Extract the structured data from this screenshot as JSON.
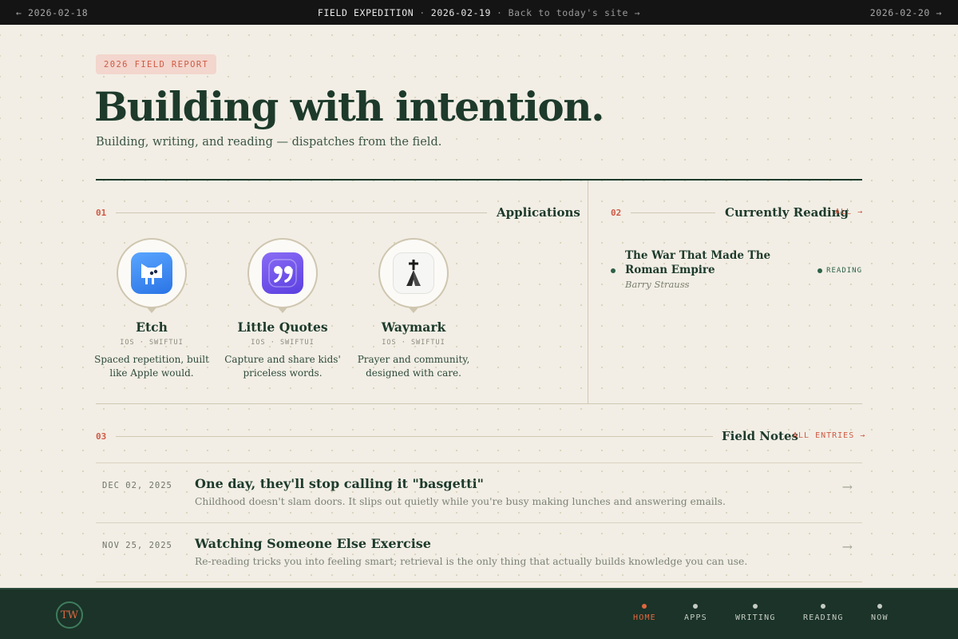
{
  "topbar": {
    "prev": "← 2026-02-18",
    "title": "FIELD EXPEDITION",
    "sep1": "·",
    "date": "2026-02-19",
    "sep2": "·",
    "back_link": "Back to today's site →",
    "next": "2026-02-20 →"
  },
  "hero": {
    "badge": "2026 FIELD REPORT",
    "title": "Building with intention.",
    "subtitle": "Building, writing, and reading — dispatches from the field."
  },
  "applications": {
    "number": "01",
    "title": "Applications",
    "items": [
      {
        "name": "Etch",
        "tags": "IOS · SWIFTUI",
        "description": "Spaced repetition, built like Apple would.",
        "icon": "etch-app-icon"
      },
      {
        "name": "Little Quotes",
        "tags": "IOS · SWIFTUI",
        "description": "Capture and share kids' priceless words.",
        "icon": "quotes-app-icon"
      },
      {
        "name": "Waymark",
        "tags": "IOS · SWIFTUI",
        "description": "Prayer and community, designed with care.",
        "icon": "praying-hands-cross-icon"
      }
    ]
  },
  "reading": {
    "number": "02",
    "title": "Currently Reading",
    "link": "ALL →",
    "book": {
      "title": "The War That Made The Roman Empire",
      "author": "Barry Strauss",
      "status": "READING"
    }
  },
  "notes": {
    "number": "03",
    "title": "Field Notes",
    "link": "ALL ENTRIES →",
    "entries": [
      {
        "date": "DEC 02, 2025",
        "title": "One day, they'll stop calling it \"basgetti\"",
        "summary": "Childhood doesn't slam doors. It slips out quietly while you're busy making lunches and answering emails.",
        "arrow": "→"
      },
      {
        "date": "NOV 25, 2025",
        "title": "Watching Someone Else Exercise",
        "summary": "Re-reading tricks you into feeling smart; retrieval is the only thing that actually builds knowledge you can use.",
        "arrow": "→"
      }
    ]
  },
  "footer": {
    "logo": "TW",
    "nav": [
      {
        "label": "HOME",
        "active": true
      },
      {
        "label": "APPS",
        "active": false
      },
      {
        "label": "WRITING",
        "active": false
      },
      {
        "label": "READING",
        "active": false
      },
      {
        "label": "NOW",
        "active": false
      }
    ]
  },
  "colors": {
    "background": "#f2eee5",
    "ink": "#1d3a2b",
    "accent": "#cf5a45",
    "footer": "#1b3328",
    "reading_green": "#2d6148"
  }
}
